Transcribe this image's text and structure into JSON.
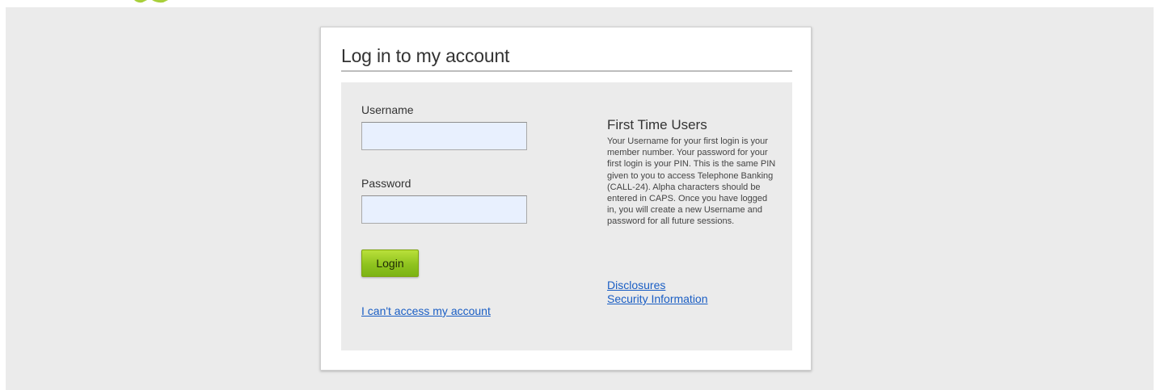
{
  "login": {
    "title": "Log in to my account",
    "username_label": "Username",
    "username_value": "",
    "password_label": "Password",
    "password_value": "",
    "login_button": "Login",
    "cant_access_link": "I can't access my account"
  },
  "first_time": {
    "title": "First Time Users",
    "text": "Your Username for your first login is your member number. Your password for your first login is your PIN. This is the same PIN given to you to access Telephone Banking (CALL-24). Alpha characters should be entered in CAPS. Once you have logged in, you will create a new Username and password for all future sessions.",
    "disclosures_link": "Disclosures",
    "security_link": "Security Information"
  },
  "colors": {
    "page_background": "#ebebeb",
    "accent_green": "#8fc31f",
    "link_blue": "#1a5ec4",
    "input_fill": "#e8f0fe"
  }
}
